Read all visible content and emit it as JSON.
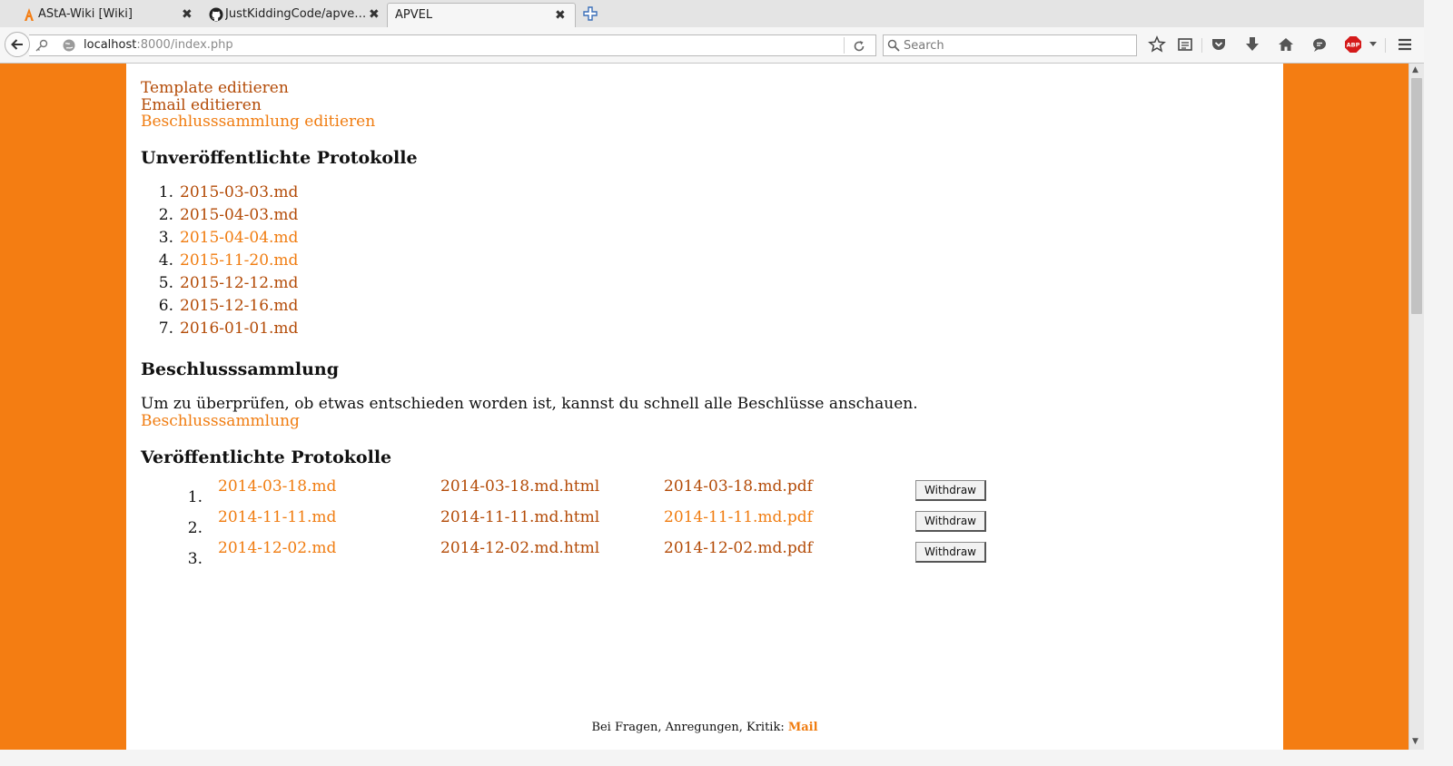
{
  "browser": {
    "tabs": [
      {
        "title": "AStA-Wiki [Wiki]",
        "icon": "asta-logo-icon",
        "active": false
      },
      {
        "title": "JustKiddingCode/apve…",
        "icon": "github-icon",
        "active": false
      },
      {
        "title": "APVEL",
        "icon": "",
        "active": true
      }
    ],
    "close_glyph": "✖",
    "url_host": "localhost",
    "url_path": ":8000/index.php",
    "search_placeholder": "Search",
    "toolbar_icons": [
      "bookmark-star-icon",
      "reading-list-icon",
      "pocket-icon",
      "download-icon",
      "home-icon",
      "chat-icon",
      "adblock-plus-icon",
      "menu-icon"
    ],
    "adblock_label": "ABP"
  },
  "page": {
    "top_links": [
      {
        "label": "Template editieren",
        "style": "dark"
      },
      {
        "label": "Email editieren",
        "style": "dark"
      },
      {
        "label": "Beschlusssammlung editieren",
        "style": "light"
      }
    ],
    "unpublished_heading": "Unveröffentlichte Protokolle",
    "unpublished": [
      {
        "num": "1.",
        "file": "2015-03-03.md",
        "style": "dark"
      },
      {
        "num": "2.",
        "file": "2015-04-03.md",
        "style": "dark"
      },
      {
        "num": "3.",
        "file": "2015-04-04.md",
        "style": "light"
      },
      {
        "num": "4.",
        "file": "2015-11-20.md",
        "style": "light"
      },
      {
        "num": "5.",
        "file": "2015-12-12.md",
        "style": "dark"
      },
      {
        "num": "6.",
        "file": "2015-12-16.md",
        "style": "dark"
      },
      {
        "num": "7.",
        "file": "2016-01-01.md",
        "style": "dark"
      }
    ],
    "beschluss_heading": "Beschlusssammlung",
    "beschluss_text": "Um zu überprüfen, ob etwas entschieden worden ist, kannst du schnell alle Beschlüsse anschauen.",
    "beschluss_link": "Beschlusssammlung",
    "published_heading": "Veröffentlichte Protokolle",
    "published": [
      {
        "num": "1.",
        "md": "2014-03-18.md",
        "md_style": "light",
        "html": "2014-03-18.md.html",
        "html_style": "dark",
        "pdf": "2014-03-18.md.pdf",
        "pdf_style": "dark",
        "button": "Withdraw"
      },
      {
        "num": "2.",
        "md": "2014-11-11.md",
        "md_style": "light",
        "html": "2014-11-11.md.html",
        "html_style": "dark",
        "pdf": "2014-11-11.md.pdf",
        "pdf_style": "light",
        "button": "Withdraw"
      },
      {
        "num": "3.",
        "md": "2014-12-02.md",
        "md_style": "light",
        "html": "2014-12-02.md.html",
        "html_style": "dark",
        "pdf": "2014-12-02.md.pdf",
        "pdf_style": "dark",
        "button": "Withdraw"
      }
    ],
    "footer_text": "Bei Fragen, Anregungen, Kritik: ",
    "footer_link": "Mail"
  },
  "colors": {
    "page_bg": "#f47d12",
    "link_dark": "#b34a06",
    "link_light": "#f07c10"
  }
}
